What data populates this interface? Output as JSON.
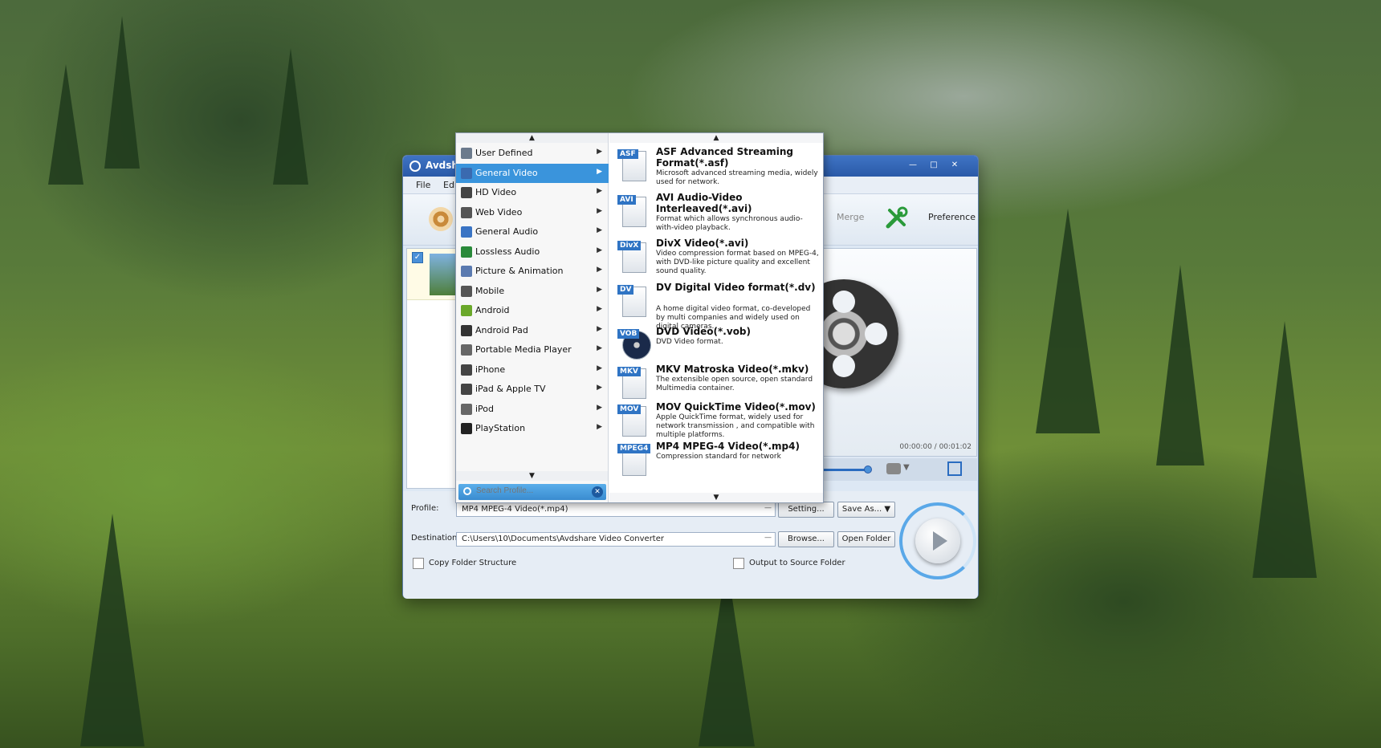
{
  "window": {
    "title": "Avdsh",
    "menu": [
      "File",
      "Edi"
    ],
    "toolbar": {
      "merge_label": "Merge",
      "preference_label": "Preference"
    }
  },
  "preview": {
    "time": "00:00:00 / 00:01:02"
  },
  "categories": [
    {
      "label": "User Defined",
      "icon": "user-icon"
    },
    {
      "label": "General Video",
      "icon": "film-icon",
      "selected": true
    },
    {
      "label": "HD Video",
      "icon": "hd-icon"
    },
    {
      "label": "Web Video",
      "icon": "web-video-icon"
    },
    {
      "label": "General Audio",
      "icon": "music-note-icon"
    },
    {
      "label": "Lossless Audio",
      "icon": "music-note-icon"
    },
    {
      "label": "Picture & Animation",
      "icon": "picture-icon"
    },
    {
      "label": "Mobile",
      "icon": "mobile-icon"
    },
    {
      "label": "Android",
      "icon": "android-icon"
    },
    {
      "label": "Android Pad",
      "icon": "tablet-icon"
    },
    {
      "label": "Portable Media Player",
      "icon": "media-player-icon"
    },
    {
      "label": "iPhone",
      "icon": "iphone-icon"
    },
    {
      "label": "iPad & Apple TV",
      "icon": "ipad-icon"
    },
    {
      "label": "iPod",
      "icon": "ipod-icon"
    },
    {
      "label": "PlayStation",
      "icon": "playstation-icon"
    }
  ],
  "search": {
    "placeholder": "Search Profile..."
  },
  "formats": [
    {
      "tag": "ASF",
      "name": "ASF Advanced Streaming Format(*.asf)",
      "desc": "Microsoft advanced streaming media, widely used for network."
    },
    {
      "tag": "AVI",
      "name": "AVI Audio-Video Interleaved(*.avi)",
      "desc": "Format which allows synchronous audio-with-video playback."
    },
    {
      "tag": "DivX",
      "name": "DivX Video(*.avi)",
      "desc": "Video compression format based on MPEG-4, with DVD-like picture quality and excellent sound quality."
    },
    {
      "tag": "DV",
      "name": "DV Digital Video format(*.dv)",
      "desc": "A home digital video format, co-developed by multi companies and widely used on digital cameras."
    },
    {
      "tag": "VOB",
      "name": "DVD Video(*.vob)",
      "desc": "DVD Video format."
    },
    {
      "tag": "MKV",
      "name": "MKV Matroska Video(*.mkv)",
      "desc": "The extensible open source, open standard Multimedia container."
    },
    {
      "tag": "MOV",
      "name": "MOV QuickTime Video(*.mov)",
      "desc": "Apple QuickTime format, widely used for network transmission , and compatible with multiple platforms."
    },
    {
      "tag": "MPEG4",
      "name": "MP4 MPEG-4 Video(*.mp4)",
      "desc": "Compression standard for network"
    }
  ],
  "bottom": {
    "profile_label": "Profile:",
    "profile_value": "MP4 MPEG-4 Video(*.mp4)",
    "setting_button": "Setting...",
    "save_as_button": "Save As...",
    "destination_label": "Destination:",
    "destination_value": "C:\\Users\\10\\Documents\\Avdshare Video Converter",
    "browse_button": "Browse...",
    "open_folder_button": "Open Folder",
    "copy_folder_label": "Copy Folder Structure",
    "output_source_label": "Output to Source Folder"
  },
  "colors": {
    "accent": "#3a94dc",
    "titlebar": "#2a5aa8"
  }
}
